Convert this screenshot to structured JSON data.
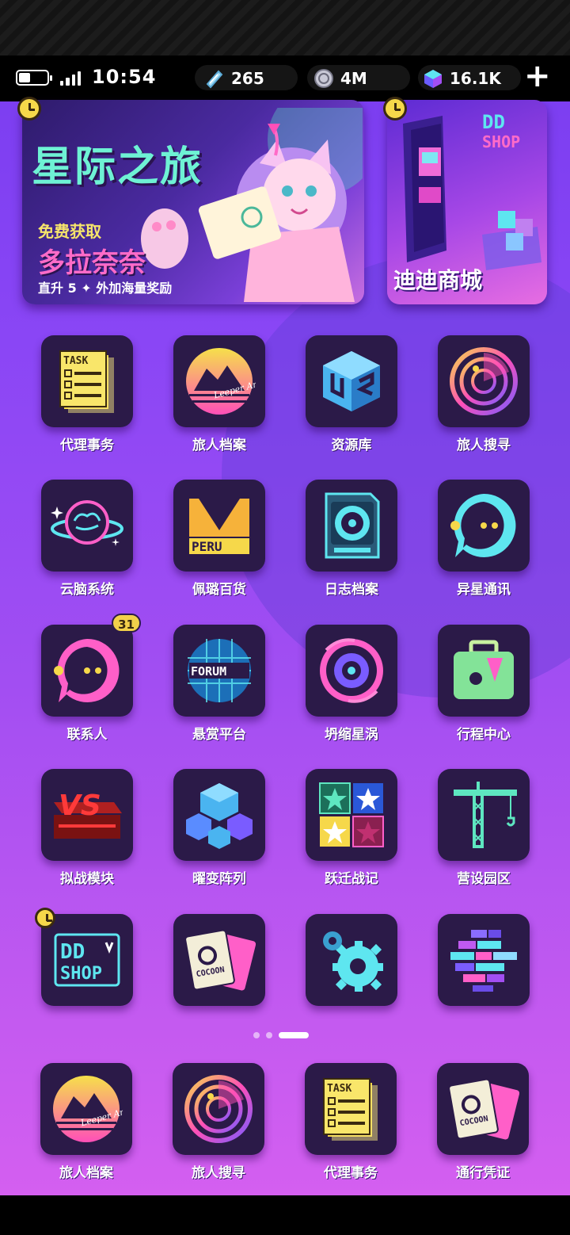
{
  "status_bar": {
    "time": "10:54",
    "resources": [
      {
        "icon": "crystal-shard-icon",
        "value": "265"
      },
      {
        "icon": "coin-icon",
        "value": "4M"
      },
      {
        "icon": "cube-gem-icon",
        "value": "16.1K"
      }
    ],
    "add_label": "+"
  },
  "banners": {
    "main": {
      "title": "星际之旅",
      "free_text": "免费获取",
      "character_name": "多拉奈奈",
      "subtitle": "直升 5 ✦ 外加海量奖励"
    },
    "shop": {
      "logo_top": "DD",
      "logo_bottom": "SHOP",
      "title": "迪迪商城"
    }
  },
  "apps": [
    {
      "label": "代理事务",
      "icon": "task-list-icon",
      "tile_text": "TASK"
    },
    {
      "label": "旅人档案",
      "icon": "leeper-archives-icon",
      "tile_text": "Leeper Archives"
    },
    {
      "label": "资源库",
      "icon": "resource-cube-icon",
      "tile_text": ""
    },
    {
      "label": "旅人搜寻",
      "icon": "radar-icon",
      "tile_text": ""
    },
    {
      "label": "云脑系统",
      "icon": "brain-planet-icon",
      "tile_text": ""
    },
    {
      "label": "佩璐百货",
      "icon": "peru-store-icon",
      "tile_text": "PERU"
    },
    {
      "label": "日志档案",
      "icon": "log-disk-icon",
      "tile_text": ""
    },
    {
      "label": "异星通讯",
      "icon": "chat-pacman-icon",
      "tile_text": ""
    },
    {
      "label": "联系人",
      "icon": "contacts-pacman-icon",
      "tile_text": "",
      "badge": "31"
    },
    {
      "label": "悬赏平台",
      "icon": "forum-globe-icon",
      "tile_text": "FORUM"
    },
    {
      "label": "坍缩星涡",
      "icon": "vortex-eye-icon",
      "tile_text": ""
    },
    {
      "label": "行程中心",
      "icon": "suitcase-icon",
      "tile_text": ""
    },
    {
      "label": "拟战模块",
      "icon": "vs-module-icon",
      "tile_text": "VS"
    },
    {
      "label": "曜变阵列",
      "icon": "cube-array-icon",
      "tile_text": ""
    },
    {
      "label": "跃迁战记",
      "icon": "star-cards-icon",
      "tile_text": ""
    },
    {
      "label": "营设园区",
      "icon": "crane-icon",
      "tile_text": ""
    },
    {
      "label": "",
      "icon": "dd-shop-icon",
      "tile_text": "DD SHOP",
      "timer": true
    },
    {
      "label": "",
      "icon": "cocoon-pass-icon",
      "tile_text": "COCOON"
    },
    {
      "label": "",
      "icon": "settings-gears-icon",
      "tile_text": ""
    },
    {
      "label": "",
      "icon": "pixel-bricks-icon",
      "tile_text": ""
    }
  ],
  "page_indicator": {
    "total": 3,
    "current": 3
  },
  "dock": [
    {
      "label": "旅人档案",
      "icon": "leeper-archives-icon",
      "tile_text": "Leeper Archives"
    },
    {
      "label": "旅人搜寻",
      "icon": "radar-icon",
      "tile_text": ""
    },
    {
      "label": "代理事务",
      "icon": "task-list-icon",
      "tile_text": "TASK"
    },
    {
      "label": "通行凭证",
      "icon": "cocoon-pass-icon",
      "tile_text": "COCOON"
    }
  ],
  "colors": {
    "tile_bg": "#2b1a48",
    "accent_yellow": "#f6d84a",
    "accent_cyan": "#5ee6f0",
    "accent_pink": "#ff5fc8"
  }
}
